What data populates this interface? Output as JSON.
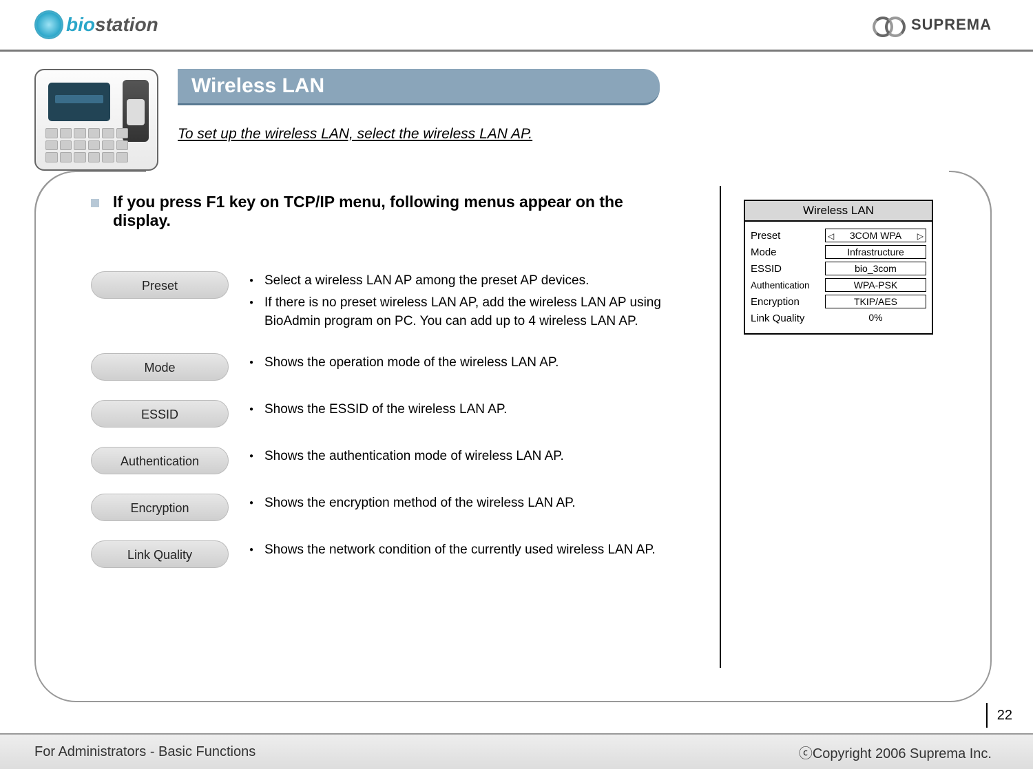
{
  "header": {
    "left_logo_text_b": "bio",
    "left_logo_text_rest": "station",
    "right_logo_text": "SUPREMA"
  },
  "banner": {
    "title": "Wireless LAN",
    "subtitle": "To set up the wireless LAN, select the wireless LAN AP."
  },
  "intro": "If you press F1 key on TCP/IP menu, following menus appear on the display.",
  "items": [
    {
      "label": "Preset",
      "bullets": [
        "Select a wireless LAN AP among the preset AP devices.",
        "If there is no preset wireless LAN AP, add the wireless LAN AP using BioAdmin program on PC. You can add up to 4 wireless LAN AP."
      ]
    },
    {
      "label": "Mode",
      "bullets": [
        "Shows the operation mode of the wireless LAN AP."
      ]
    },
    {
      "label": "ESSID",
      "bullets": [
        "Shows the ESSID of the wireless LAN AP."
      ]
    },
    {
      "label": "Authentication",
      "bullets": [
        "Shows the authentication mode of wireless LAN AP."
      ]
    },
    {
      "label": "Encryption",
      "bullets": [
        "Shows the encryption method of the wireless LAN AP."
      ]
    },
    {
      "label": "Link Quality",
      "bullets": [
        "Shows the network condition of the currently used wireless LAN AP."
      ]
    }
  ],
  "screen": {
    "title": "Wireless LAN",
    "rows": [
      {
        "label": "Preset",
        "value": "3COM WPA",
        "arrows": true
      },
      {
        "label": "Mode",
        "value": "Infrastructure",
        "arrows": false
      },
      {
        "label": "ESSID",
        "value": "bio_3com",
        "arrows": false
      },
      {
        "label": "Authentication",
        "value": "WPA-PSK",
        "arrows": false
      },
      {
        "label": "Encryption",
        "value": "TKIP/AES",
        "arrows": false
      },
      {
        "label": "Link Quality",
        "value": "0%",
        "arrows": false,
        "noborder": true
      }
    ]
  },
  "footer": {
    "left": "For Administrators - Basic Functions",
    "right": "ⓒCopyright 2006 Suprema Inc.",
    "page": "22"
  }
}
